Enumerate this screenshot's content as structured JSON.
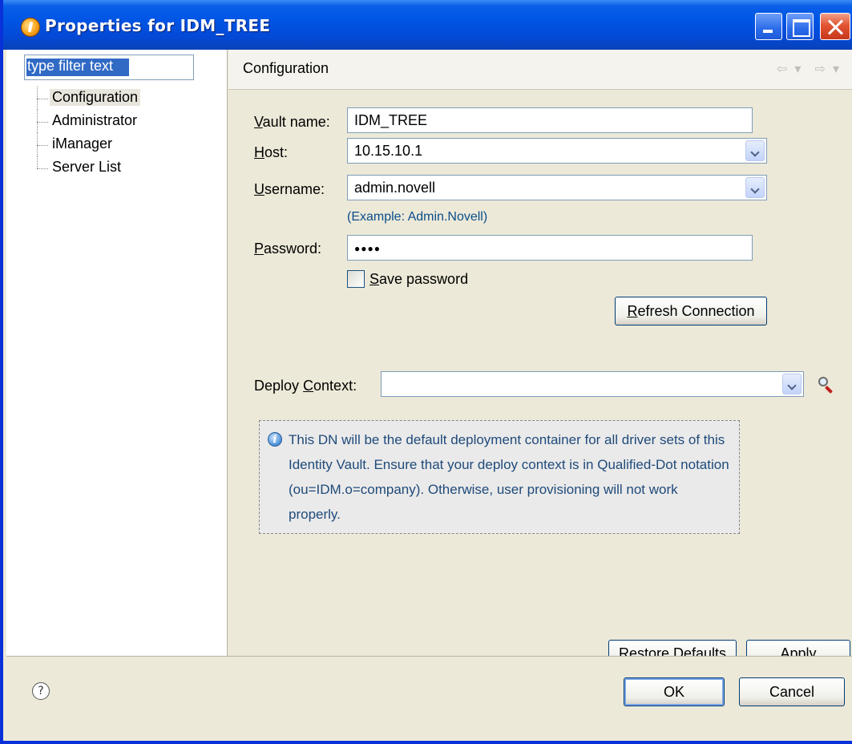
{
  "window": {
    "title": "Properties for IDM_TREE"
  },
  "sidebar": {
    "filter_placeholder": "type filter text",
    "items": [
      {
        "label": "Configuration",
        "selected": true
      },
      {
        "label": "Administrator"
      },
      {
        "label": "iManager"
      },
      {
        "label": "Server List"
      }
    ]
  },
  "page": {
    "title": "Configuration",
    "nav_back_icon": "back-arrow-icon",
    "nav_forward_icon": "forward-arrow-icon"
  },
  "form": {
    "vault_name": {
      "label_pre": "",
      "label_key": "V",
      "label_rest": "ault name:",
      "value": "IDM_TREE"
    },
    "host": {
      "label_key": "H",
      "label_rest": "ost:",
      "value": "10.15.10.1"
    },
    "username": {
      "label_key": "U",
      "label_rest": "sername:",
      "value": "admin.novell",
      "hint": "(Example:  Admin.Novell)"
    },
    "password": {
      "label_key": "P",
      "label_rest": "assword:",
      "value": "●●●●"
    },
    "save_password": {
      "label_key": "S",
      "label_rest": "ave password",
      "checked": false
    },
    "refresh_button": {
      "label_key": "R",
      "label_rest": "efresh Connection"
    },
    "deploy_context": {
      "label_pre": "Deploy ",
      "label_key": "C",
      "label_rest": "ontext:",
      "value": ""
    },
    "info_text": "This DN will be the default deployment container for all driver sets of this Identity Vault. Ensure that your deploy context is in Qualified-Dot notation (ou=IDM.o=company). Otherwise, user provisioning will not work properly."
  },
  "page_buttons": {
    "restore_defaults_pre": "Restore ",
    "restore_defaults_key": "D",
    "restore_defaults_rest": "efaults",
    "apply_key": "A",
    "apply_rest": "pply"
  },
  "dialog_buttons": {
    "ok": "OK",
    "cancel": "Cancel"
  }
}
